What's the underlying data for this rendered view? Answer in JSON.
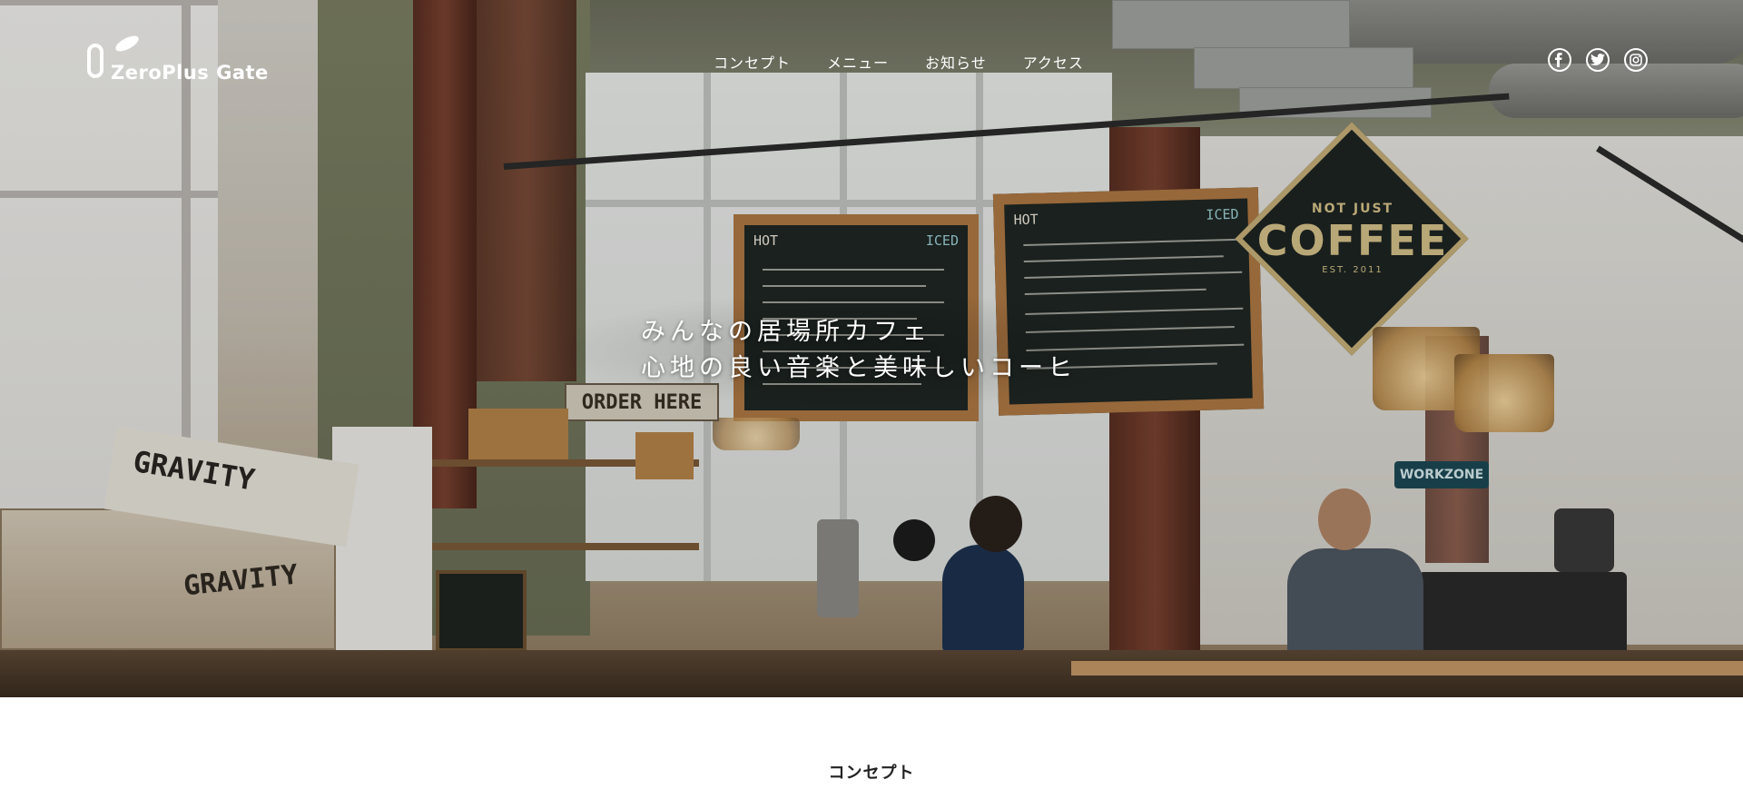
{
  "site": {
    "logo_text": "ZeroPlus Gate"
  },
  "nav": {
    "items": [
      {
        "label": "コンセプト"
      },
      {
        "label": "メニュー"
      },
      {
        "label": "お知らせ"
      },
      {
        "label": "アクセス"
      }
    ]
  },
  "social": {
    "icons": [
      "facebook-icon",
      "twitter-icon",
      "instagram-icon"
    ]
  },
  "hero": {
    "line1": "みんなの居場所カフェ",
    "line2": "心地の良い音楽と美味しいコーヒ",
    "image_subject": "cafe interior with chalkboard menus and baristas",
    "signage": {
      "diamond_top": "NOT JUST",
      "diamond_main": "COFFEE",
      "diamond_bottom": "EST. 2011",
      "order": "ORDER HERE",
      "crate": "GRAVITY",
      "workzone": "WORKZONE",
      "board_left_hot": "HOT",
      "board_left_iced": "ICED",
      "board_right_hot": "HOT",
      "board_right_iced": "ICED"
    }
  },
  "concept": {
    "heading": "コンセプト"
  },
  "colors": {
    "accent_text": "#ffffff",
    "heading_text": "#222222"
  }
}
